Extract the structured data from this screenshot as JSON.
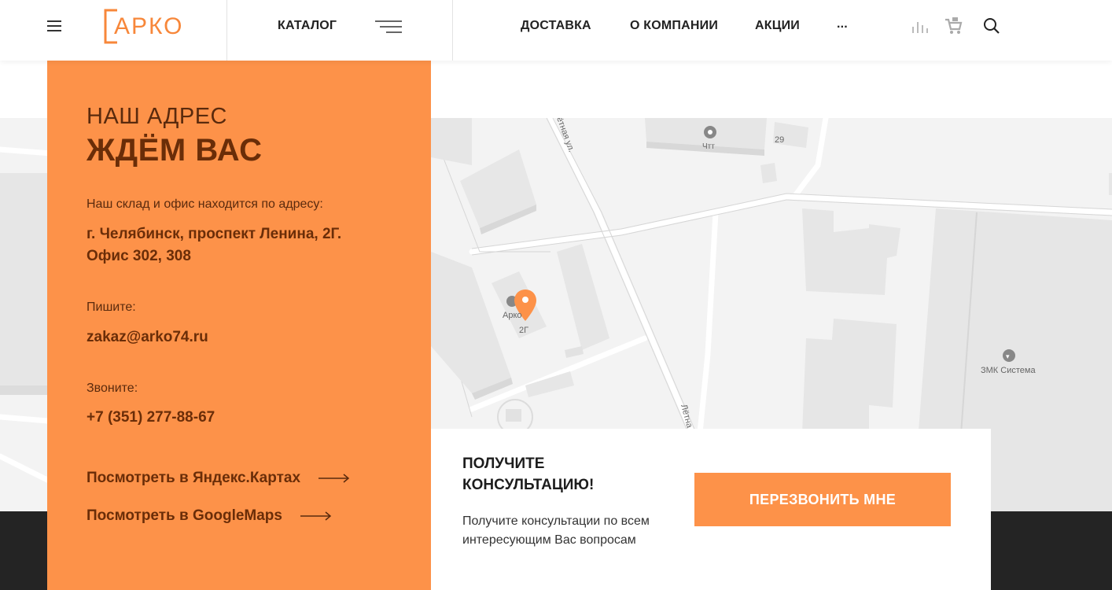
{
  "header": {
    "logo": "АРКО",
    "nav": {
      "catalog": "КАТАЛОГ",
      "delivery": "ДОСТАВКА",
      "about": "О КОМПАНИИ",
      "sales": "АКЦИИ",
      "more": "..."
    },
    "icons": [
      "menu-icon",
      "catalog-lines-icon",
      "compare-icon",
      "cart-icon",
      "search-icon"
    ]
  },
  "address": {
    "subtitle": "НАШ АДРЕС",
    "title": "ЖДЁМ ВАС",
    "intro": "Наш склад и офис находится по адресу:",
    "line1": "г. Челябинск, проспект Ленина, 2Г.",
    "line2": "Офис 302, 308",
    "write_label": "Пишите:",
    "email": "zakaz@arko74.ru",
    "call_label": "Звоните:",
    "phone": "+7 (351) 277-88-67",
    "yandex_link": "Посмотреть в Яндекс.Картах",
    "google_link": "Посмотреть в GoogleMaps"
  },
  "map": {
    "labels": {
      "street_top": "ётная ул.",
      "street_bottom": "Лётна",
      "poi_1": "Чтт",
      "house_29": "29",
      "arko_name": "Арко",
      "arko_house": "2Г",
      "poi_2": "ЗМК Система"
    },
    "colors": {
      "background": "#f3f3f3",
      "building": "#e6e6e6",
      "pin": "#fd9249"
    }
  },
  "consultation": {
    "title": "ПОЛУЧИТЕ КОНСУЛЬТАЦИЮ!",
    "text": "Получите консультации по всем интересующим Вас вопросам",
    "button": "ПЕРЕЗВОНИТЬ МНЕ"
  },
  "colors": {
    "accent": "#fd9249",
    "accent_dark": "#6a2d08",
    "footer": "#242424"
  }
}
